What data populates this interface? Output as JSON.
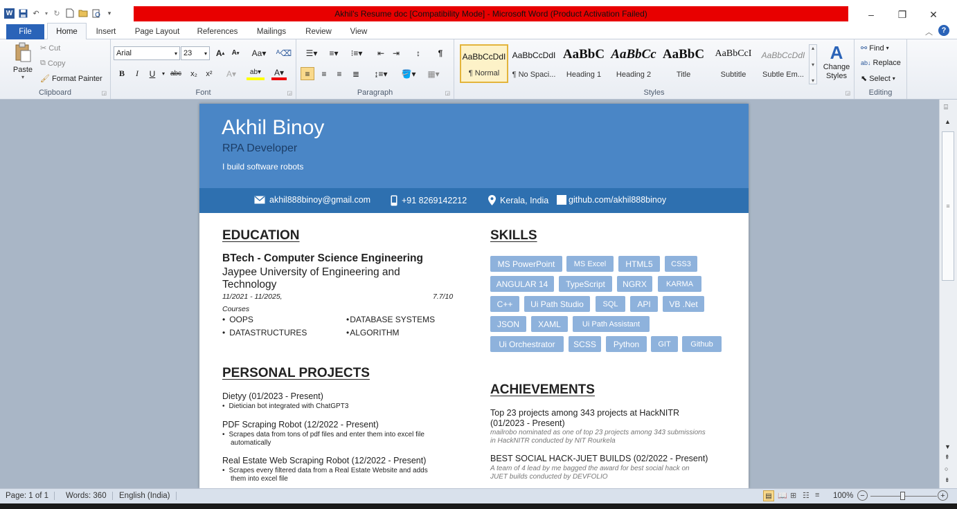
{
  "window": {
    "title": "Akhil's Resume doc [Compatibility Mode]  -  Microsoft Word (Product Activation Failed)",
    "title_bg": "#e80000",
    "controls": [
      "–",
      "❐",
      "✕"
    ]
  },
  "tabs": [
    "File",
    "Home",
    "Insert",
    "Page Layout",
    "References",
    "Mailings",
    "Review",
    "View"
  ],
  "clipboard": {
    "paste": "Paste",
    "cut": "Cut",
    "copy": "Copy",
    "format_painter": "Format Painter",
    "label": "Clipboard"
  },
  "font": {
    "name": "Arial",
    "size": "23",
    "label": "Font"
  },
  "paragraph": {
    "label": "Paragraph"
  },
  "styles": {
    "items": [
      {
        "preview": "AaBbCcDdI",
        "name": "¶ Normal"
      },
      {
        "preview": "AaBbCcDdI",
        "name": "¶ No Spaci..."
      },
      {
        "preview": "AaBbC",
        "name": "Heading 1"
      },
      {
        "preview": "AaBbCc",
        "name": "Heading 2"
      },
      {
        "preview": "AaBbC",
        "name": "Title"
      },
      {
        "preview": "AaBbCcI",
        "name": "Subtitle"
      },
      {
        "preview": "AaBbCcDdI",
        "name": "Subtle Em..."
      }
    ],
    "change_styles": "Change Styles",
    "label": "Styles"
  },
  "editing": {
    "find": "Find",
    "replace": "Replace",
    "select": "Select",
    "label": "Editing"
  },
  "resume": {
    "name": "Akhil Binoy",
    "role": "RPA Developer",
    "tagline": "I build software robots",
    "email": "akhil888binoy@gmail.com",
    "phone": "+91 8269142212",
    "location": "Kerala, India",
    "github": "github.com/akhil888binoy",
    "education": {
      "heading": "EDUCATION",
      "degree": "BTech - Computer Science Engineering",
      "school_line1": "Jaypee University of Engineering and",
      "school_line2": "Technology",
      "dates": "11/2021 - 11/2025,",
      "gpa": "7.7/10",
      "courses_label": "Courses",
      "courses": [
        "OOPS",
        "DATABASE SYSTEMS",
        "DATASTRUCTURES",
        "ALGORITHM"
      ]
    },
    "projects": {
      "heading": "PERSONAL PROJECTS",
      "items": [
        {
          "title": "Dietyy (01/2023  - Present)",
          "bullets": [
            "Dietician bot integrated with ChatGPT3"
          ]
        },
        {
          "title": "PDF Scraping Robot (12/2022  - Present)",
          "bullets": [
            "Scrapes data from tons of pdf files and enter them into excel file",
            "automatically"
          ]
        },
        {
          "title": "Real Estate Web Scraping Robot (12/2022  - Present)",
          "bullets": [
            "Scrapes every filtered data from a Real Estate Website and adds",
            "them into excel file"
          ]
        }
      ]
    },
    "skills": {
      "heading": "SKILLS",
      "items": [
        "MS PowerPoint",
        "MS  Excel",
        "HTML5",
        "CSS3",
        "ANGULAR 14",
        "TypeScript",
        "NGRX",
        "KARMA",
        "C++",
        "Ui Path Studio",
        "SQL",
        "API",
        "VB .Net",
        "JSON",
        "XAML",
        "Ui  Path  Assistant",
        "Ui Orchestrator",
        "SCSS",
        "Python",
        "GIT",
        "Github"
      ]
    },
    "achievements": {
      "heading": "ACHIEVEMENTS",
      "items": [
        {
          "title1": "Top 23 projects among 343 projects at HackNITR",
          "title2": " (01/2023  - Present)",
          "desc1": "mailrobo nominated as one of top 23 projects among 343 submissions",
          "desc2": "in HackNITR conducted by NIT Rourkela"
        },
        {
          "title1": "BEST SOCIAL HACK-JUET BUILDS (02/2022 - Present)",
          "title2": "",
          "desc1": "A team of 4 lead by me bagged the award for best social hack on",
          "desc2": "JUET builds conducted by DEVFOLIO"
        }
      ]
    }
  },
  "status": {
    "page": "Page: 1 of 1",
    "words": "Words: 360",
    "language": "English (India)",
    "zoom": "100%"
  },
  "colors": {
    "header_bg": "#4a86c6",
    "contact_bg": "#2e70b0",
    "chip_bg": "#8eb2dc",
    "file_tab": "#2a63b8"
  }
}
